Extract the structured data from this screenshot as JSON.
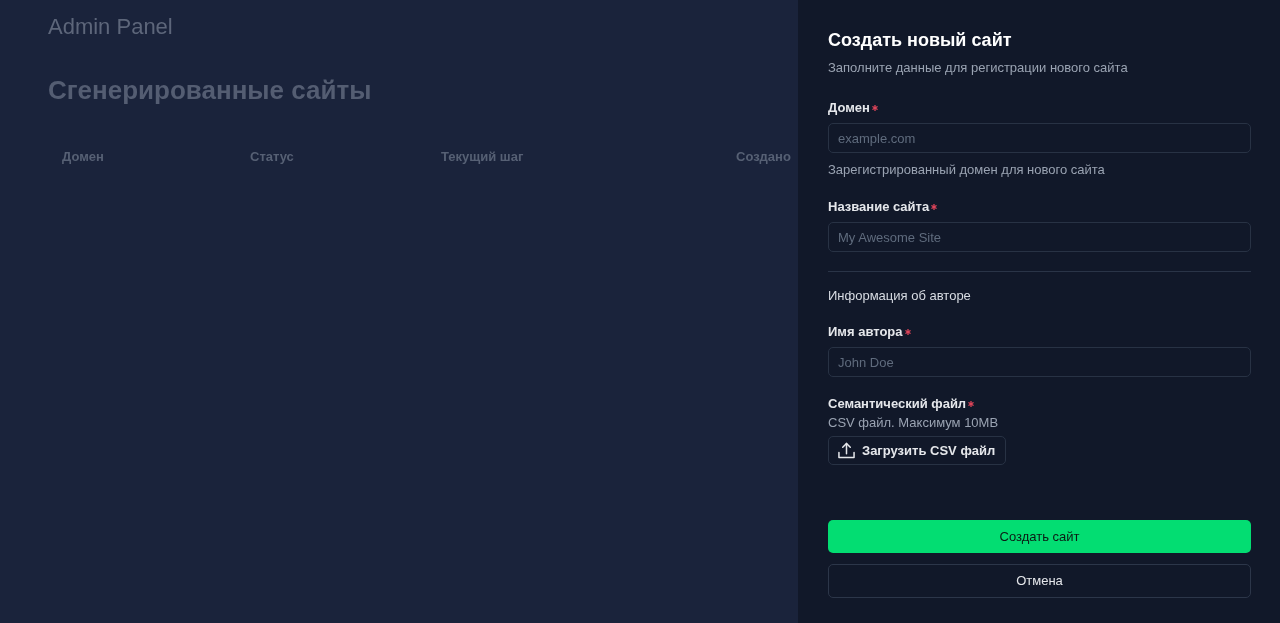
{
  "page": {
    "brand": "Admin Panel",
    "heading": "Сгенерированные сайты",
    "table": {
      "columns": [
        "Домен",
        "Статус",
        "Текущий шаг",
        "Создано"
      ]
    }
  },
  "dialog": {
    "title": "Создать новый сайт",
    "description": "Заполните данные для регистрации нового сайта",
    "fields": [
      {
        "kind": "text",
        "label": "Домен",
        "required": true,
        "placeholder": "example.com",
        "hint": "Зарегистрированный домен для нового сайта"
      },
      {
        "kind": "text",
        "label": "Название сайта",
        "required": true,
        "placeholder": "My Awesome Site"
      },
      {
        "kind": "section",
        "title": "Информация об авторе"
      },
      {
        "kind": "text",
        "label": "Имя автора",
        "required": true,
        "placeholder": "John Doe"
      },
      {
        "kind": "file",
        "label": "Семантический файл",
        "required": true,
        "hint": "CSV файл. Максимум 10MB",
        "button": "Загрузить CSV файл"
      }
    ],
    "actions": [
      {
        "kind": "primary",
        "label": "Создать сайт"
      },
      {
        "kind": "secondary",
        "label": "Отмена"
      }
    ]
  }
}
